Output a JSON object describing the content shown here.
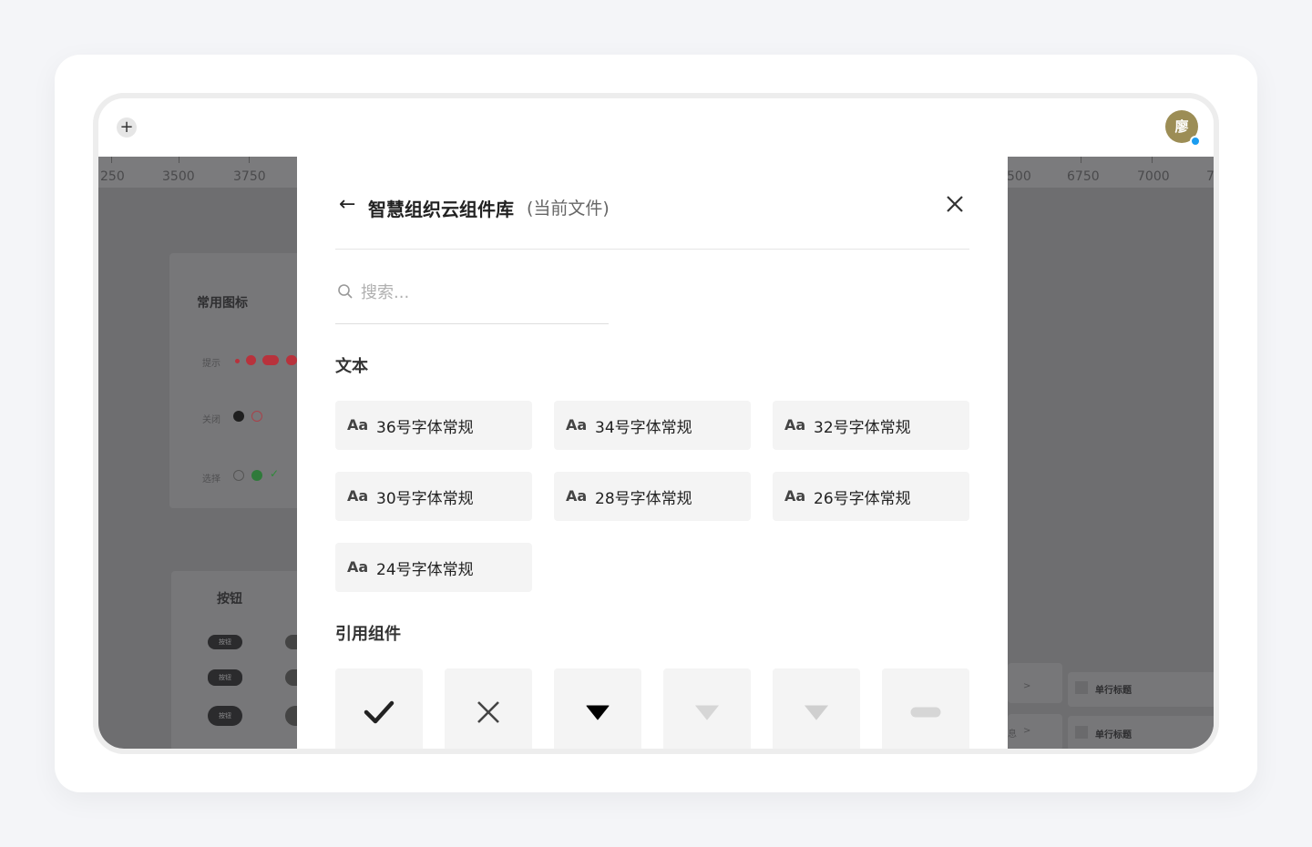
{
  "topbar": {
    "plus_label": "+",
    "avatar_initial": "廖"
  },
  "ruler": {
    "ticks": [
      "250",
      "3500",
      "3750",
      "500",
      "6750",
      "7000",
      "7"
    ]
  },
  "background": {
    "panel1_title": "常用图标",
    "row_hint": "提示",
    "row_close": "关闭",
    "row_select": "选择",
    "panel2_title": "按钮",
    "button_label": "按钮",
    "list_title_1": "单行标题",
    "list_title_2": "单行标题",
    "list_char": "息"
  },
  "modal": {
    "back_icon": "←",
    "title": "智慧组织云组件库",
    "subtitle": "(当前文件)",
    "search_placeholder": "搜索...",
    "section_text": "文本",
    "section_components": "引用组件",
    "text_items": [
      {
        "prefix": "Aa",
        "label": "36号字体常规"
      },
      {
        "prefix": "Aa",
        "label": "34号字体常规"
      },
      {
        "prefix": "Aa",
        "label": "32号字体常规"
      },
      {
        "prefix": "Aa",
        "label": "30号字体常规"
      },
      {
        "prefix": "Aa",
        "label": "28号字体常规"
      },
      {
        "prefix": "Aa",
        "label": "26号字体常规"
      },
      {
        "prefix": "Aa",
        "label": "24号字体常规"
      }
    ],
    "components": [
      {
        "icon": "check-icon",
        "color": "#222222"
      },
      {
        "icon": "close-icon",
        "color": "#444444"
      },
      {
        "icon": "triangle-down-icon",
        "color": "#000000"
      },
      {
        "icon": "triangle-down-icon",
        "color": "#d6d6d6"
      },
      {
        "icon": "triangle-down-icon",
        "color": "#cfcfcf"
      },
      {
        "icon": "minus-bar-icon",
        "color": "#d6d6d6"
      }
    ]
  }
}
